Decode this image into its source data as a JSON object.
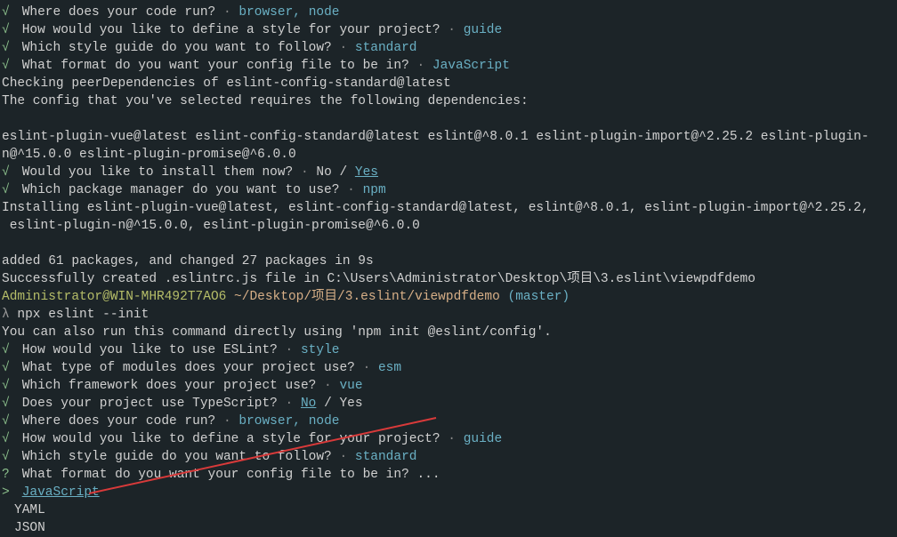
{
  "lines": {
    "q_run_where": "Where does your code run?",
    "a_browser": "browser",
    "a_node": "node",
    "q_style_define": "How would you like to define a style for your project?",
    "a_guide": "guide",
    "q_style_which": "Which style guide do you want to follow?",
    "a_standard": "standard",
    "q_format": "What format do you want your config file to be in?",
    "a_javascript": "JavaScript",
    "checking_peer": "Checking peerDependencies of eslint-config-standard@latest",
    "config_selected": "The config that you've selected requires the following dependencies:",
    "deps_line1": "eslint-plugin-vue@latest eslint-config-standard@latest eslint@^8.0.1 eslint-plugin-import@^2.25.2 eslint-plugin-",
    "deps_line2": "n@^15.0.0 eslint-plugin-promise@^6.0.0",
    "q_install_now": "Would you like to install them now?",
    "a_no": "No",
    "a_yes": "Yes",
    "q_pkg_manager": "Which package manager do you want to use?",
    "a_npm": "npm",
    "installing_1": "Installing eslint-plugin-vue@latest, eslint-config-standard@latest, eslint@^8.0.1, eslint-plugin-import@^2.25.2,",
    "installing_2": " eslint-plugin-n@^15.0.0, eslint-plugin-promise@^6.0.0",
    "added_pkgs": "added 61 packages, and changed 27 packages in 9s",
    "success_created": "Successfully created .eslintrc.js file in C:\\Users\\Administrator\\Desktop\\项目\\3.eslint\\viewpdfdemo",
    "prompt_user": "Administrator@WIN-MHR492T7AO6",
    "prompt_path": " ~/Desktop/项目/3.eslint/viewpdfdemo ",
    "prompt_branch": "(master)",
    "lambda": "λ",
    "cmd": " npx eslint --init",
    "can_also": "You can also run this command directly using 'npm init @eslint/config'.",
    "q_use_eslint": "How would you like to use ESLint?",
    "a_style": "style",
    "q_modules": "What type of modules does your project use?",
    "a_esm": "esm",
    "q_framework": "Which framework does your project use?",
    "a_vue": "vue",
    "q_typescript": "Does your project use TypeScript?",
    "a_no2": "No",
    "a_yes2": "Yes",
    "q_format_open": "What format do you want your config file to be in? ...",
    "opt_javascript": "JavaScript",
    "opt_yaml": "YAML",
    "opt_json": "JSON",
    "sep": " · ",
    "slash": " / ",
    "comma": ", ",
    "space": " "
  }
}
